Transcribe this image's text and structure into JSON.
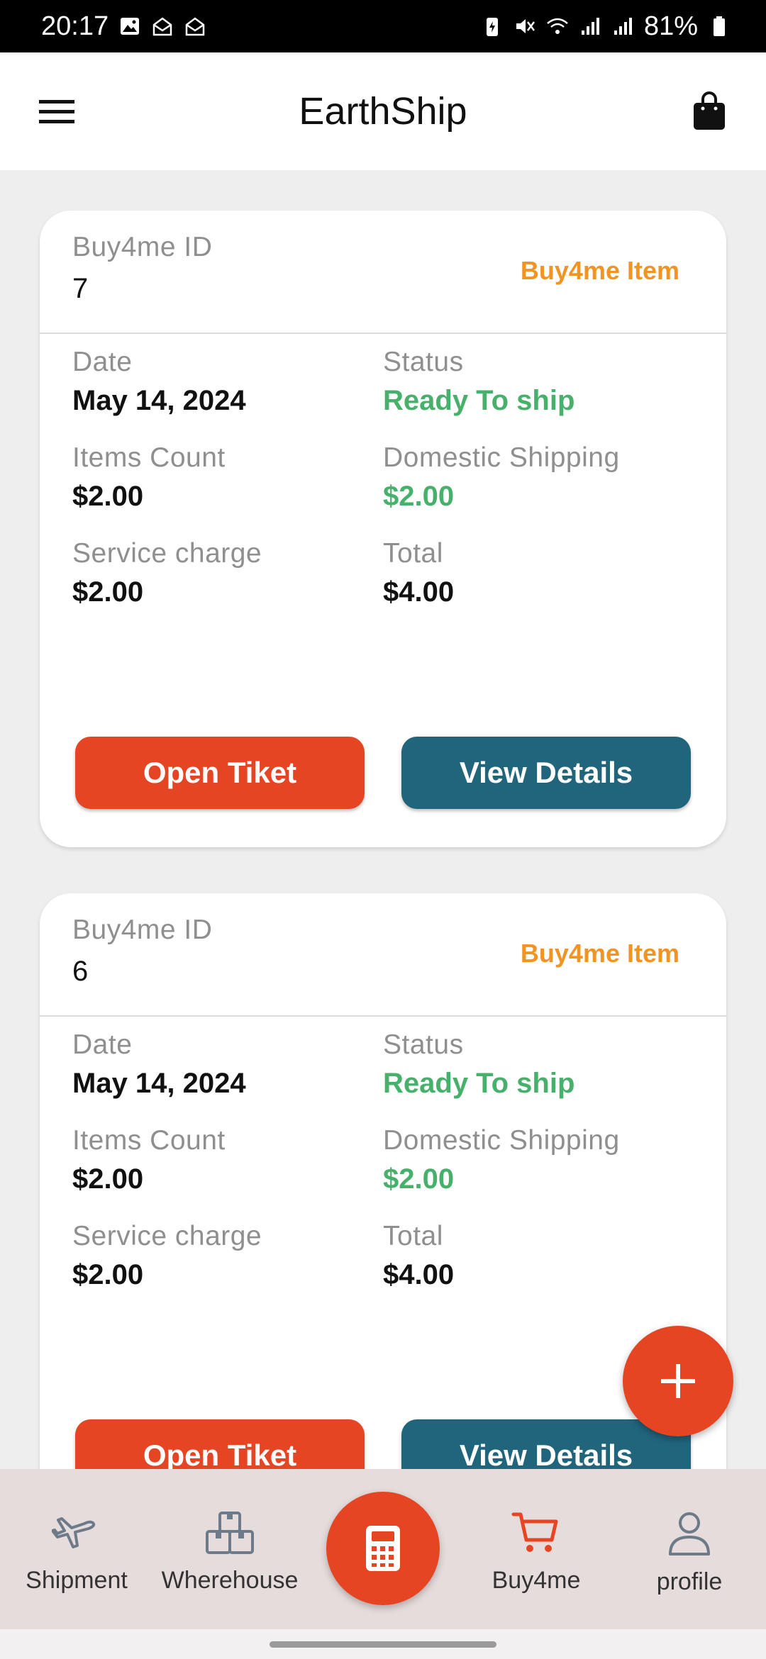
{
  "status_bar": {
    "time": "20:17",
    "battery": "81%"
  },
  "app_bar": {
    "title": "EarthShip",
    "menu_icon": "hamburger-menu-icon",
    "bag_icon": "shopping-bag-icon"
  },
  "orders": [
    {
      "id_label": "Buy4me ID",
      "id_value": "7",
      "type": "Buy4me Item",
      "date_label": "Date",
      "date_value": "May 14, 2024",
      "status_label": "Status",
      "status_value": "Ready To ship",
      "items_count_label": "Items Count",
      "items_count_value": "$2.00",
      "domestic_label": "Domestic Shipping",
      "domestic_value": "$2.00",
      "service_label": "Service charge",
      "service_value": "$2.00",
      "total_label": "Total",
      "total_value": "$4.00",
      "open_ticket_label": "Open Tiket",
      "view_details_label": "View Details"
    },
    {
      "id_label": "Buy4me ID",
      "id_value": "6",
      "type": "Buy4me Item",
      "date_label": "Date",
      "date_value": "May 14, 2024",
      "status_label": "Status",
      "status_value": "Ready To ship",
      "items_count_label": "Items Count",
      "items_count_value": "$2.00",
      "domestic_label": "Domestic Shipping",
      "domestic_value": "$2.00",
      "service_label": "Service charge",
      "service_value": "$2.00",
      "total_label": "Total",
      "total_value": "$4.00",
      "open_ticket_label": "Open Tiket",
      "view_details_label": "View Details"
    }
  ],
  "bottom_nav": {
    "items": [
      {
        "label": "Shipment",
        "icon": "airplane-icon"
      },
      {
        "label": "Wherehouse",
        "icon": "boxes-icon"
      },
      {
        "label": "",
        "icon": "calculator-icon"
      },
      {
        "label": "Buy4me",
        "icon": "cart-icon"
      },
      {
        "label": "profile",
        "icon": "user-icon"
      }
    ]
  },
  "colors": {
    "accent": "#e64524",
    "teal": "#21657d",
    "green": "#47b06b",
    "badge_orange": "#f29422"
  }
}
